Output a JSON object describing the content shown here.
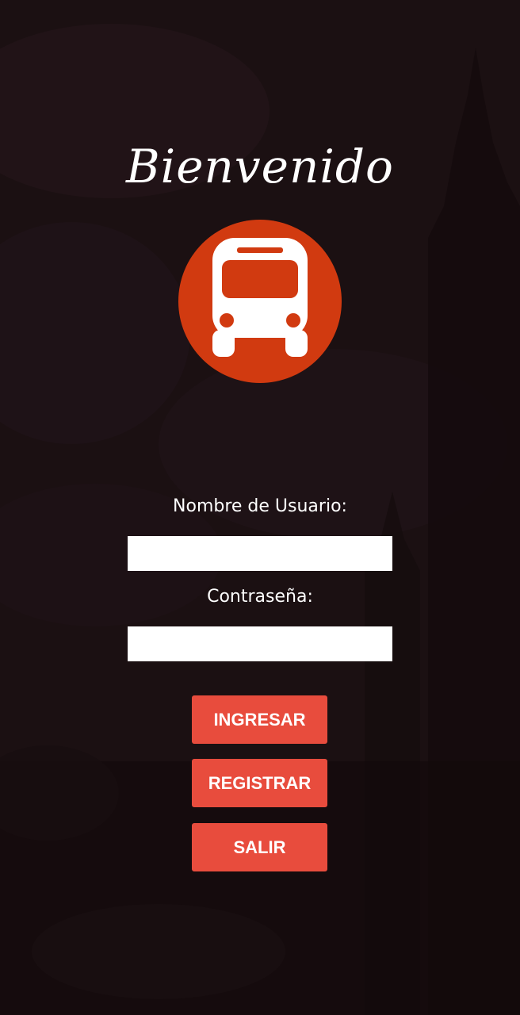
{
  "header": {
    "title": "Bienvenido",
    "logo_icon": "bus-icon"
  },
  "form": {
    "username_label": "Nombre de Usuario:",
    "username_value": "",
    "password_label": "Contraseña:",
    "password_value": ""
  },
  "buttons": {
    "login_label": "INGRESAR",
    "register_label": "REGISTRAR",
    "exit_label": "SALIR"
  },
  "colors": {
    "background": "#1a1011",
    "logo_circle": "#d13a10",
    "button": "#e84c3d"
  }
}
